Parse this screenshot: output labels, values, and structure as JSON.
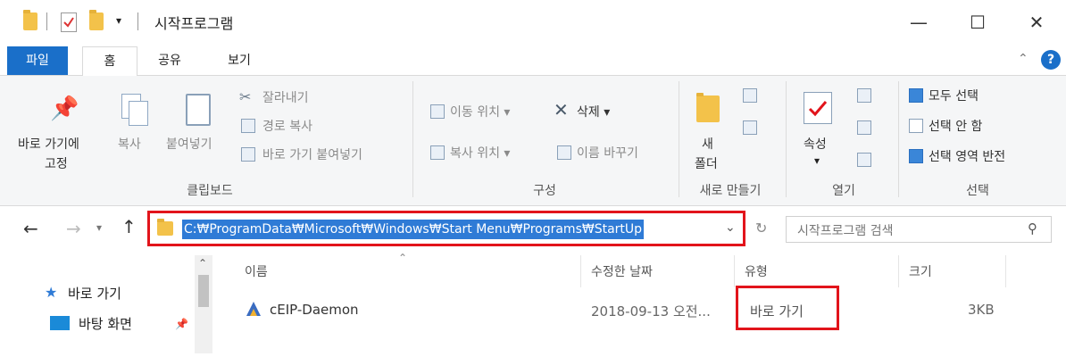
{
  "window": {
    "title": "시작프로그램",
    "minimize": "—",
    "maximize": "☐",
    "close": "✕"
  },
  "ribbon_tabs": [
    "파일",
    "홈",
    "공유",
    "보기"
  ],
  "ribbon": {
    "pin_label_1": "바로 가기에",
    "pin_label_2": "고정",
    "copy": "복사",
    "paste": "붙여넣기",
    "cut": "잘라내기",
    "copy_path": "경로 복사",
    "paste_shortcut": "바로 가기 붙여넣기",
    "clipboard_group": "클립보드",
    "move_to": "이동 위치",
    "copy_to": "복사 위치",
    "delete": "삭제",
    "rename": "이름 바꾸기",
    "organize_group": "구성",
    "new_folder_1": "새",
    "new_folder_2": "폴더",
    "new_group": "새로 만들기",
    "properties": "속성",
    "open_group": "열기",
    "select_all": "모두 선택",
    "select_none": "선택 안 함",
    "invert_selection": "선택 영역 반전",
    "select_group": "선택"
  },
  "address": {
    "path": "C:₩ProgramData₩Microsoft₩Windows₩Start Menu₩Programs₩StartUp",
    "search_placeholder": "시작프로그램 검색"
  },
  "nav_pane": {
    "quick_access": "바로 가기",
    "desktop": "바탕 화면"
  },
  "columns": [
    "이름",
    "수정한 날짜",
    "유형",
    "크기"
  ],
  "files": [
    {
      "name": "cEIP-Daemon",
      "modified": "2018-09-13 오전...",
      "type": "바로 가기",
      "size": "3KB"
    }
  ],
  "colors": {
    "accent": "#1a6fc9",
    "highlight": "#e2141b",
    "selection": "#2f7bd6"
  }
}
